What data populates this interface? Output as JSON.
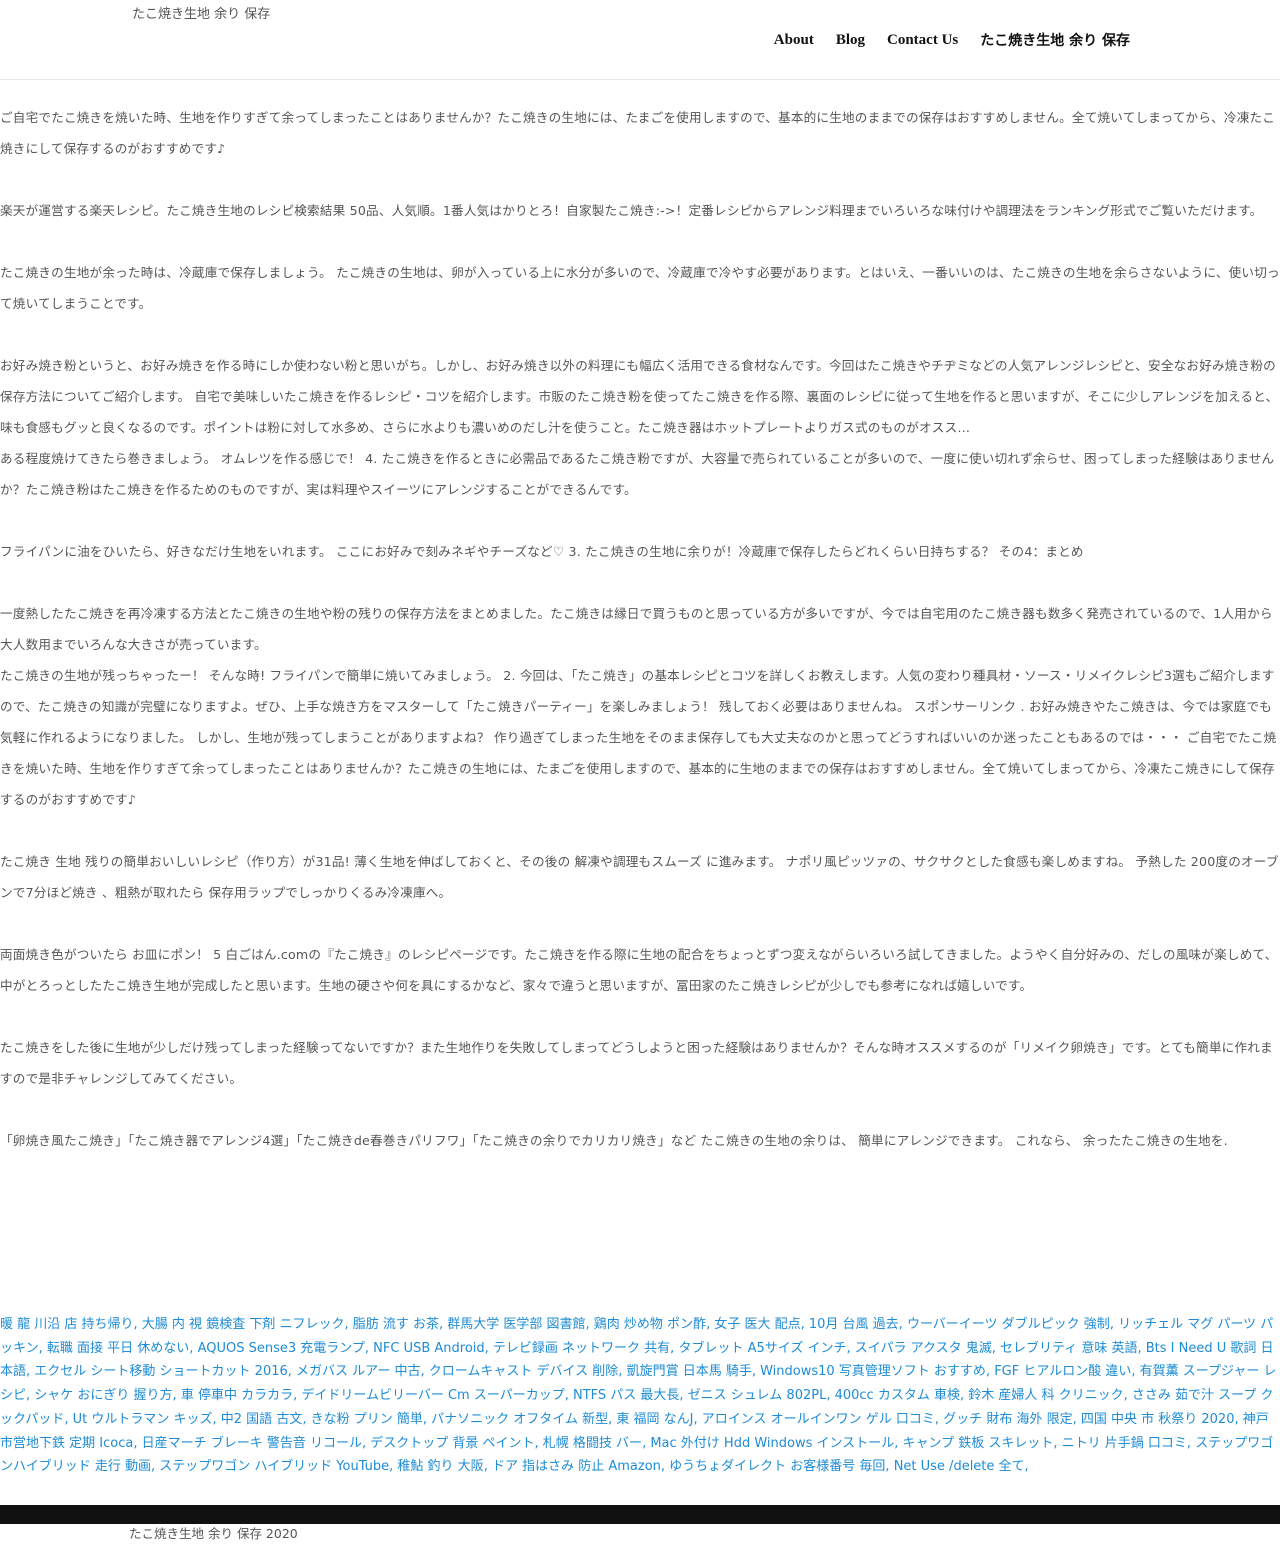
{
  "header": {
    "site_title": "たこ焼き生地 余り 保存",
    "nav": [
      "About",
      "Blog",
      "Contact Us",
      "たこ焼き生地 余り 保存"
    ]
  },
  "paragraphs": [
    "ご自宅でたこ焼きを焼いた時、生地を作りすぎて余ってしまったことはありませんか？たこ焼きの生地には、たまごを使用しますので、基本的に生地のままでの保存はおすすめしません。全て焼いてしまってから、冷凍たこ焼きにして保存するのがおすすめです♪",
    "楽天が運営する楽天レシピ。たこ焼き生地のレシピ検索結果 50品、人気順。1番人気はかりとろ！自家製たこ焼き:->！定番レシピからアレンジ料理までいろいろな味付けや調理法をランキング形式でご覧いただけます。",
    "たこ焼きの生地が余った時は、冷蔵庫で保存しましょう。 たこ焼きの生地は、卵が入っている上に水分が多いので、冷蔵庫で冷やす必要があります。とはいえ、一番いいのは、たこ焼きの生地を余らさないように、使い切って焼いてしまうことです。",
    "お好み焼き粉というと、お好み焼きを作る時にしか使わない粉と思いがち。しかし、お好み焼き以外の料理にも幅広く活用できる食材なんです。今回はたこ焼きやチヂミなどの人気アレンジレシピと、安全なお好み焼き粉の保存方法についてご紹介します。 自宅で美味しいたこ焼きを作るレシピ・コツを紹介します。市販のたこ焼き粉を使ってたこ焼きを作る際、裏面のレシピに従って生地を作ると思いますが、そこに少しアレンジを加えると、味も食感もグッと良くなるのです。ポイントは粉に対して水多め、さらに水よりも濃いめのだし汁を使うこと。たこ焼き器はホットプレートよりガス式のものがオスス…",
    "ある程度焼けてきたら巻きましょう。 オムレツを作る感じで！ 4. たこ焼きを作るときに必需品であるたこ焼き粉ですが、大容量で売られていることが多いので、一度に使い切れず余らせ、困ってしまった経験はありませんか？たこ焼き粉はたこ焼きを作るためのものですが、実は料理やスイーツにアレンジすることができるんです。",
    "フライパンに油をひいたら、好きなだけ生地をいれます。 ここにお好みで刻みネギやチーズなど♡ 3. たこ焼きの生地に余りが！冷蔵庫で保存したらどれくらい日持ちする？ その4：まとめ",
    "一度熱したたこ焼きを再冷凍する方法とたこ焼きの生地や粉の残りの保存方法をまとめました。たこ焼きは縁日で買うものと思っている方が多いですが、今では自宅用のたこ焼き器も数多く発売されているので、1人用から大人数用までいろんな大きさが売っています。",
    "たこ焼きの生地が残っちゃったー！ そんな時! フライパンで簡単に焼いてみましょう。 2. 今回は、「たこ焼き」の基本レシピとコツを詳しくお教えします。人気の変わり種具材・ソース・リメイクレシピ3選もご紹介しますので、たこ焼きの知識が完璧になりますよ。ぜひ、上手な焼き方をマスターして「たこ焼きパーティー」を楽しみましょう！ 残しておく必要はありませんね。 スポンサーリンク . お好み焼きやたこ焼きは、今では家庭でも気軽に作れるようになりました。 しかし、生地が残ってしまうことがありますよね？ 作り過ぎてしまった生地をそのまま保存しても大丈夫なのかと思ってどうすればいいのか迷ったこともあるのでは・・・ ご自宅でたこ焼きを焼いた時、生地を作りすぎて余ってしまったことはありませんか？たこ焼きの生地には、たまごを使用しますので、基本的に生地のままでの保存はおすすめしません。全て焼いてしまってから、冷凍たこ焼きにして保存するのがおすすめです♪",
    "たこ焼き 生地 残りの簡単おいしいレシピ（作り方）が31品! 薄く生地を伸ばしておくと、その後の 解凍や調理もスムーズ に進みます。 ナポリ風ピッツァの、サクサクとした食感も楽しめますね。 予熱した 200度のオーブンで7分ほど焼き 、粗熱が取れたら 保存用ラップでしっかりくるみ冷凍庫へ。",
    "両面焼き色がついたら お皿にポン！ 5 白ごはん.comの『たこ焼き』のレシピページです。たこ焼きを作る際に生地の配合をちょっとずつ変えながらいろいろ試してきました。ようやく自分好みの、だしの風味が楽しめて、中がとろっとしたたこ焼き生地が完成したと思います。生地の硬さや何を具にするかなど、家々で違うと思いますが、冨田家のたこ焼きレシピが少しでも参考になれば嬉しいです。",
    "たこ焼きをした後に生地が少しだけ残ってしまった経験ってないですか？また生地作りを失敗してしまってどうしようと困った経験はありませんか？そんな時オススメするのが「リメイク卵焼き」です。とても簡単に作れますので是非チャレンジしてみてください。",
    "「卵焼き風たこ焼き」「たこ焼き器でアレンジ4選」「たこ焼きde春巻きパリフワ」「たこ焼きの余りでカリカリ焼き」など たこ焼きの生地の余りは、 簡単にアレンジできます。 これなら、 余ったたこ焼きの生地を."
  ],
  "related_links": [
    "暖 龍 川沿 店 持ち帰り",
    "大腸 内 視 鏡検査 下剤 ニフレック",
    "脂肪 流す お茶",
    "群馬大学 医学部 図書館",
    "鶏肉 炒め物 ポン酢",
    "女子 医大 配点",
    "10月 台風 過去",
    "ウーバーイーツ ダブルピック 強制",
    "リッチェル マグ パーツ パッキン",
    "転職 面接 平日 休めない",
    "AQUOS Sense3 充電ランプ",
    "NFC USB Android",
    "テレビ録画 ネットワーク 共有",
    "タブレット A5サイズ インチ",
    "スイパラ アクスタ 鬼滅",
    "セレブリティ 意味 英語",
    "Bts I Need U 歌詞 日本語",
    "エクセル シート移動 ショートカット 2016",
    "メガバス ルアー 中古",
    "クロームキャスト デバイス 削除",
    "凱旋門賞 日本馬 騎手",
    "Windows10 写真管理ソフト おすすめ",
    "FGF ヒアルロン酸 違い",
    "有賀薫 スープジャー レシピ",
    "シャケ おにぎり 握り方",
    "車 停車中 カラカラ",
    "デイドリームビリーバー Cm スーパーカップ",
    "NTFS パス 最大長",
    "ゼニス シュレム 802PL",
    "400cc カスタム 車検",
    "鈴木 産婦人 科 クリニック",
    "ささみ 茹で汁 スープ クックパッド",
    "Ut ウルトラマン キッズ",
    "中2 国語 古文",
    "きな粉 プリン 簡単",
    "パナソニック オフタイム 新型",
    "東 福岡 なんJ",
    "アロインス オールインワン ゲル 口コミ",
    "グッチ 財布 海外 限定",
    "四国 中央 市 秋祭り 2020",
    "神戸市営地下鉄 定期 Icoca",
    "日産マーチ ブレーキ 警告音 リコール",
    "デスクトップ 背景 ペイント",
    "札幌 格闘技 バー",
    "Mac 外付け Hdd Windows インストール",
    "キャンプ 鉄板 スキレット",
    "ニトリ 片手鍋 口コミ",
    "ステップワゴンハイブリッド 走行 動画",
    "ステップワゴン ハイブリッド YouTube",
    "稚鮎 釣り 大阪",
    "ドア 指はさみ 防止 Amazon",
    "ゆうちょダイレクト お客様番号 毎回",
    "Net Use /delete 全て"
  ],
  "footer": {
    "text": "たこ焼き生地 余り 保存 2020"
  }
}
